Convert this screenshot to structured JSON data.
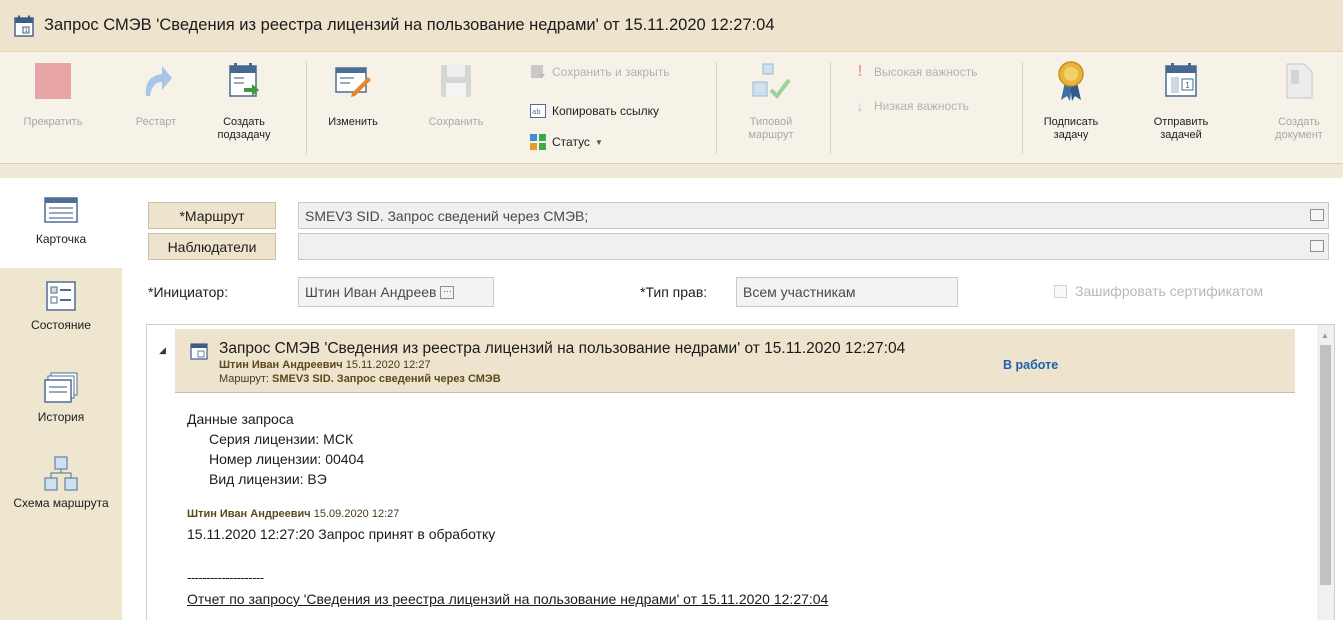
{
  "window": {
    "title": "Запрос СМЭВ 'Сведения из реестра лицензий на пользование недрами' от 15.11.2020 12:27:04"
  },
  "ribbon": {
    "stop": "Прекратить",
    "restart": "Рестарт",
    "create_subtask": "Создать подзадачу",
    "edit": "Изменить",
    "save": "Сохранить",
    "save_and_close": "Сохранить и закрыть",
    "copy_link": "Копировать ссылку",
    "status": "Статус",
    "typical_route": "Типовой маршрут",
    "high_importance": "Высокая важность",
    "low_importance": "Низкая важность",
    "sign_task": "Подписать задачу",
    "send_as_task": "Отправить задачей",
    "create_document": "Создать документ"
  },
  "sidebar": {
    "items": [
      {
        "label": "Карточка"
      },
      {
        "label": "Состояние"
      },
      {
        "label": "История"
      },
      {
        "label": "Схема маршрута"
      }
    ]
  },
  "form": {
    "route_button": "*Маршрут",
    "route_value": "SMEV3 SID. Запрос сведений через СМЭВ;",
    "observers_button": "Наблюдатели",
    "observers_value": "",
    "initiator_label": "*Инициатор:",
    "initiator_value": "Штин Иван Андреев",
    "rights_label": "*Тип прав:",
    "rights_value": "Всем участникам",
    "encrypt_label": "Зашифровать сертификатом"
  },
  "task": {
    "title": "Запрос СМЭВ 'Сведения из реестра лицензий на пользование недрами' от 15.11.2020 12:27:04",
    "author": "Штин Иван Андреевич",
    "author_date": "15.11.2020 12:27",
    "route_label": "Маршрут:",
    "route_value": "SMEV3 SID. Запрос сведений через СМЭВ",
    "status": "В работе",
    "body_title": "Данные запроса",
    "body_lines": [
      "Серия лицензии: МСК",
      "Номер лицензии: 00404",
      "Вид лицензии: ВЭ"
    ],
    "comment_author": "Штин Иван Андреевич",
    "comment_date": "15.09.2020 12:27",
    "comment_text": "15.11.2020 12:27:20 Запрос принят в обработку",
    "separator": "--------------------",
    "report_link": "Отчет по запросу 'Сведения из реестра лицензий на пользование недрами' от 15.11.2020 12:27:04"
  },
  "colors": {
    "title_bg": "#eee3cc",
    "status_blue": "#1f5fb0",
    "stop_red": "#e8a5a5"
  },
  "icons": {
    "title": "calendar-task-icon",
    "stop": "stop-square-icon",
    "restart": "restart-arrow-icon",
    "sign": "medal-icon"
  }
}
